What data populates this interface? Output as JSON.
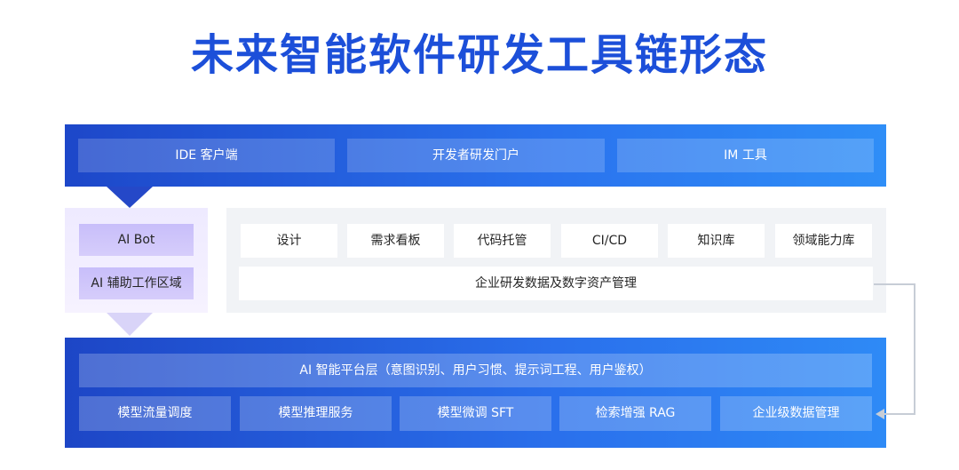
{
  "title": "未来智能软件研发工具链形态",
  "top_layer": {
    "items": [
      "IDE 客户端",
      "开发者研发门户",
      "IM 工具"
    ]
  },
  "ai_assist": {
    "items": [
      "AI Bot",
      "AI 辅助工作区域"
    ]
  },
  "tools_layer": {
    "items": [
      "设计",
      "需求看板",
      "代码托管",
      "CI/CD",
      "知识库",
      "领域能力库"
    ],
    "data_label": "企业研发数据及数字资产管理"
  },
  "platform_layer": {
    "title": "AI 智能平台层（意图识别、用户习惯、提示词工程、用户鉴权）",
    "items": [
      "模型流量调度",
      "模型推理服务",
      "模型微调 SFT",
      "检索增强 RAG",
      "企业级数据管理"
    ]
  },
  "colors": {
    "title": "#1c4fd9",
    "blue_band_start": "#1d47c9",
    "blue_band_end": "#2f8ef7",
    "purple_panel": "#eeeaff",
    "purple_button": "#c8befa",
    "grey_panel": "#f1f3f6",
    "connector": "#c7cdd6"
  }
}
